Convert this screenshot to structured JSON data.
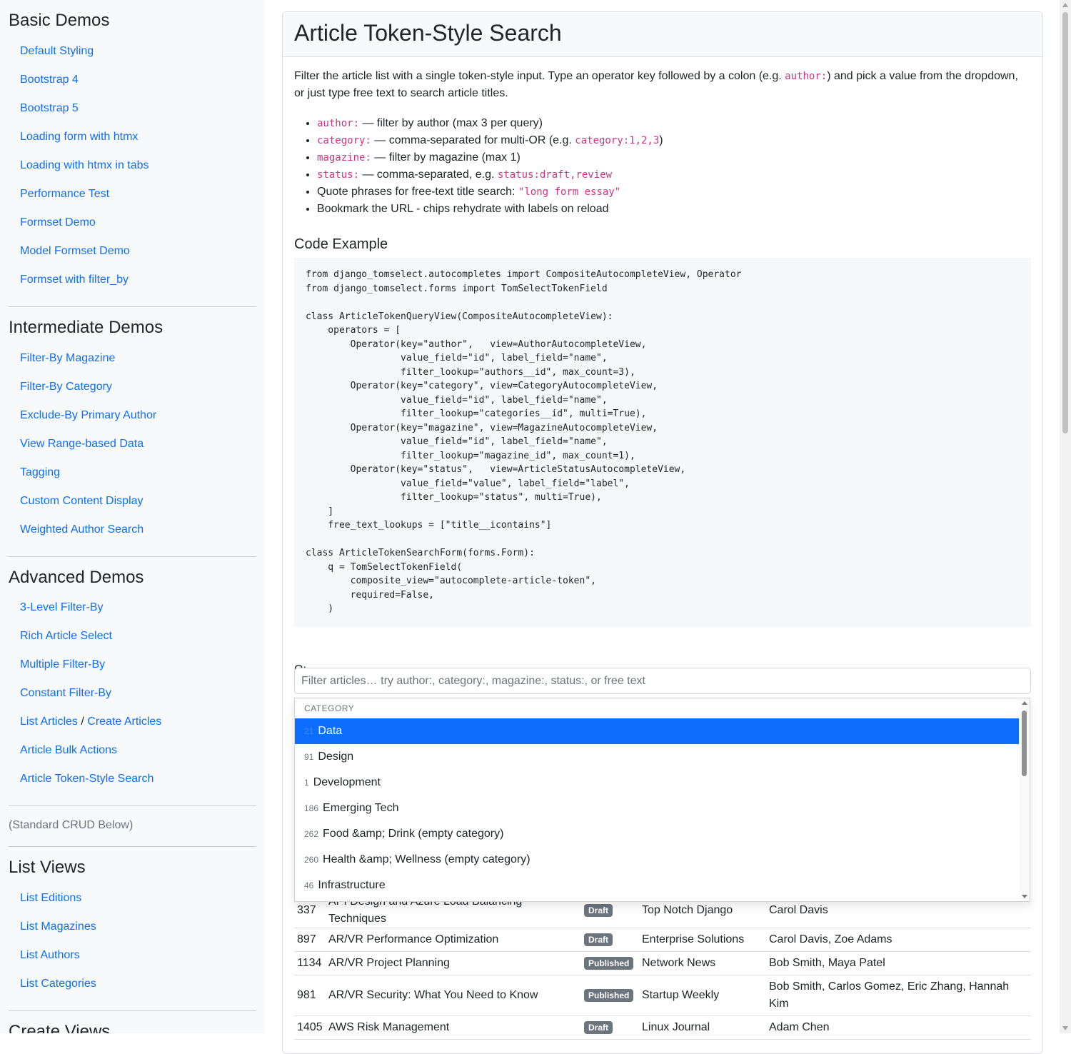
{
  "sidebar": {
    "sections": [
      {
        "heading": "Basic Demos",
        "items": [
          "Default Styling",
          "Bootstrap 4",
          "Bootstrap 5",
          "Loading form with htmx",
          "Loading with htmx in tabs",
          "Performance Test",
          "Formset Demo",
          "Model Formset Demo",
          "Formset with filter_by"
        ]
      },
      {
        "heading": "Intermediate Demos",
        "items": [
          "Filter-By Magazine",
          "Filter-By Category",
          "Exclude-By Primary Author",
          "View Range-based Data",
          "Tagging",
          "Custom Content Display",
          "Weighted Author Search"
        ]
      },
      {
        "heading": "Advanced Demos",
        "items": [
          "3-Level Filter-By",
          "Rich Article Select",
          "Multiple Filter-By",
          "Constant Filter-By"
        ],
        "split_item": {
          "first": "List Articles",
          "separator": " / ",
          "second": "Create Articles"
        },
        "items_after": [
          "Article Bulk Actions",
          "Article Token-Style Search"
        ]
      }
    ],
    "crud_note": "(Standard CRUD Below)",
    "list_views": {
      "heading": "List Views",
      "items": [
        "List Editions",
        "List Magazines",
        "List Authors",
        "List Categories"
      ]
    },
    "create_views_heading": "Create Views"
  },
  "main": {
    "title": "Article Token-Style Search",
    "intro": {
      "part1": "Filter the article list with a single token-style input. Type an operator key followed by a colon (e.g. ",
      "code": "author:",
      "part2": ") and pick a value from the dropdown, or just type free text to search article titles."
    },
    "operators": [
      {
        "code": "author:",
        "text": " — filter by author (max 3 per query)"
      },
      {
        "code": "category:",
        "text": " — comma-separated for multi-OR (e.g. ",
        "code2": "category:1,2,3",
        "text2": ")"
      },
      {
        "code": "magazine:",
        "text": " — filter by magazine (max 1)"
      },
      {
        "code": "status:",
        "text": " — comma-separated, e.g. ",
        "code2": "status:draft,review"
      },
      {
        "text": "Quote phrases for free-text title search: ",
        "code2": "\"long form essay\""
      },
      {
        "text": "Bookmark the URL - chips rehydrate with labels on reload"
      }
    ],
    "code_heading": "Code Example",
    "code": "from django_tomselect.autocompletes import CompositeAutocompleteView, Operator\nfrom django_tomselect.forms import TomSelectTokenField\n\nclass ArticleTokenQueryView(CompositeAutocompleteView):\n    operators = [\n        Operator(key=\"author\",   view=AuthorAutocompleteView,\n                 value_field=\"id\", label_field=\"name\",\n                 filter_lookup=\"authors__id\", max_count=3),\n        Operator(key=\"category\", view=CategoryAutocompleteView,\n                 value_field=\"id\", label_field=\"name\",\n                 filter_lookup=\"categories__id\", multi=True),\n        Operator(key=\"magazine\", view=MagazineAutocompleteView,\n                 value_field=\"id\", label_field=\"name\",\n                 filter_lookup=\"magazine_id\", max_count=1),\n        Operator(key=\"status\",   view=ArticleStatusAutocompleteView,\n                 value_field=\"value\", label_field=\"label\",\n                 filter_lookup=\"status\", multi=True),\n    ]\n    free_text_lookups = [\"title__icontains\"]\n\nclass ArticleTokenSearchForm(forms.Form):\n    q = TomSelectTokenField(\n        composite_view=\"autocomplete-article-token\",\n        required=False,\n    )",
    "q_label": "Q:",
    "q_placeholder": "Filter articles… try author:, category:, magazine:, status:, or free text",
    "q_value": ""
  },
  "dropdown": {
    "group": "CATEGORY",
    "options": [
      {
        "id": "21",
        "label": "Data",
        "active": true
      },
      {
        "id": "91",
        "label": "Design"
      },
      {
        "id": "1",
        "label": "Development"
      },
      {
        "id": "186",
        "label": "Emerging Tech"
      },
      {
        "id": "262",
        "label": "Food &amp; Drink (empty category)"
      },
      {
        "id": "260",
        "label": "Health &amp; Wellness (empty category)"
      },
      {
        "id": "46",
        "label": "Infrastructure"
      }
    ]
  },
  "results": [
    {
      "id": "337",
      "title": "API Design and Azure Load Balancing Techniques",
      "status": "Draft",
      "magazine": "Top Notch Django",
      "authors": "Carol Davis"
    },
    {
      "id": "897",
      "title": "AR/VR Performance Optimization",
      "status": "Draft",
      "magazine": "Enterprise Solutions",
      "authors": "Carol Davis, Zoe Adams"
    },
    {
      "id": "1134",
      "title": "AR/VR Project Planning",
      "status": "Published",
      "magazine": "Network News",
      "authors": "Bob Smith, Maya Patel"
    },
    {
      "id": "981",
      "title": "AR/VR Security: What You Need to Know",
      "status": "Published",
      "magazine": "Startup Weekly",
      "authors": "Bob Smith, Carlos Gomez, Eric Zhang, Hannah Kim"
    },
    {
      "id": "1405",
      "title": "AWS Risk Management",
      "status": "Draft",
      "magazine": "Linux Journal",
      "authors": "Adam Chen"
    }
  ]
}
